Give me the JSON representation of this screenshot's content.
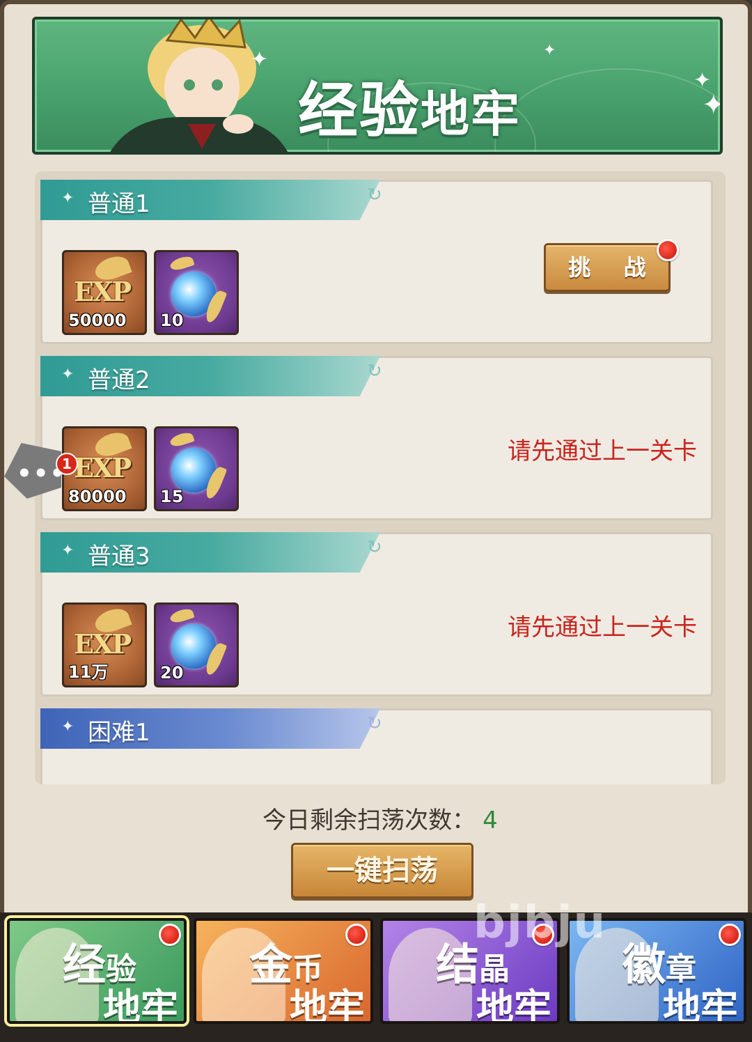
{
  "banner": {
    "title_big": "经验",
    "title_small": "地牢"
  },
  "levels": [
    {
      "name": "普通1",
      "rewards": [
        {
          "icon": "exp-icon",
          "qty": "50000"
        },
        {
          "icon": "orb-icon",
          "qty": "10"
        }
      ],
      "action": "挑 战",
      "status": ""
    },
    {
      "name": "普通2",
      "rewards": [
        {
          "icon": "exp-icon",
          "qty": "80000"
        },
        {
          "icon": "orb-icon",
          "qty": "15"
        }
      ],
      "action": "",
      "status": "请先通过上一关卡"
    },
    {
      "name": "普通3",
      "rewards": [
        {
          "icon": "exp-icon",
          "qty": "11万"
        },
        {
          "icon": "orb-icon",
          "qty": "20"
        }
      ],
      "action": "",
      "status": "请先通过上一关卡"
    },
    {
      "name": "困难1"
    }
  ],
  "exp_logo": "EXP",
  "sweep": {
    "label": "今日剩余扫荡次数：",
    "count": "4",
    "button": "一键扫荡"
  },
  "chat": {
    "dots": "•••",
    "badge": "1"
  },
  "tabs": [
    {
      "line1a": "经",
      "line1b": "验",
      "line2": "地牢"
    },
    {
      "line1a": "金",
      "line1b": "币",
      "line2": "地牢"
    },
    {
      "line1a": "结",
      "line1b": "晶",
      "line2": "地牢"
    },
    {
      "line1a": "徽",
      "line1b": "章",
      "line2": "地牢"
    }
  ],
  "watermark": "bjbju",
  "colors": {
    "locked_text": "#c8241e",
    "count_green": "#2d8a3a",
    "banner_green": "#47a06b"
  }
}
